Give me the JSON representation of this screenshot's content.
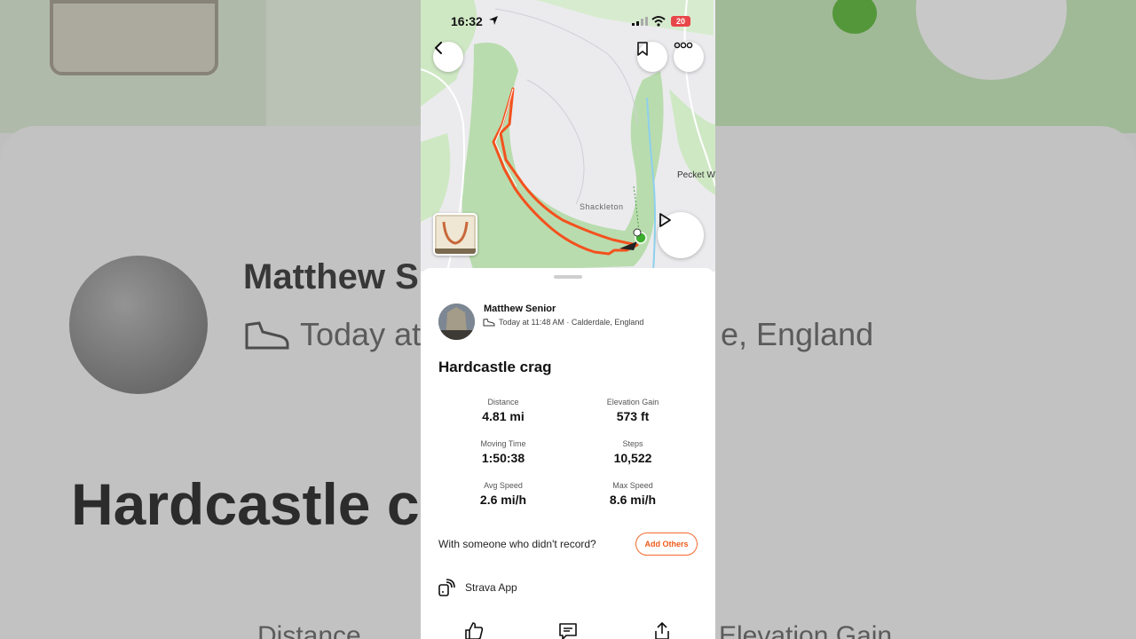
{
  "status_bar": {
    "time": "16:32",
    "battery": "20"
  },
  "map": {
    "labels": {
      "shackleton": "Shackleton",
      "pecket": "Pecket W"
    },
    "route_color": "#f4511e"
  },
  "background": {
    "name": "Matthew S",
    "subtitle_left": "Today at",
    "subtitle_right": "e, England",
    "title": "Hardcastle c",
    "distance": "Distance",
    "elevation": "Elevation Gain"
  },
  "activity": {
    "athlete": "Matthew Senior",
    "meta": "Today at 11:48 AM · Calderdale, England",
    "title": "Hardcastle crag",
    "stats": [
      {
        "label": "Distance",
        "value": "4.81 mi"
      },
      {
        "label": "Elevation Gain",
        "value": "573 ft"
      },
      {
        "label": "Moving Time",
        "value": "1:50:38"
      },
      {
        "label": "Steps",
        "value": "10,522"
      },
      {
        "label": "Avg Speed",
        "value": "2.6 mi/h"
      },
      {
        "label": "Max Speed",
        "value": "8.6 mi/h"
      }
    ],
    "prompt": "With someone who didn't record?",
    "add_others": "Add Others",
    "device": "Strava App"
  },
  "colors": {
    "accent": "#f05a1a",
    "map_green": "#bfe0b3"
  },
  "icons": [
    "location-arrow-icon",
    "signal-icon",
    "wifi-icon",
    "back-chevron-icon",
    "bookmark-icon",
    "more-icon",
    "play-icon",
    "shoe-icon",
    "device-icon",
    "kudos-icon",
    "comment-icon",
    "share-icon"
  ]
}
